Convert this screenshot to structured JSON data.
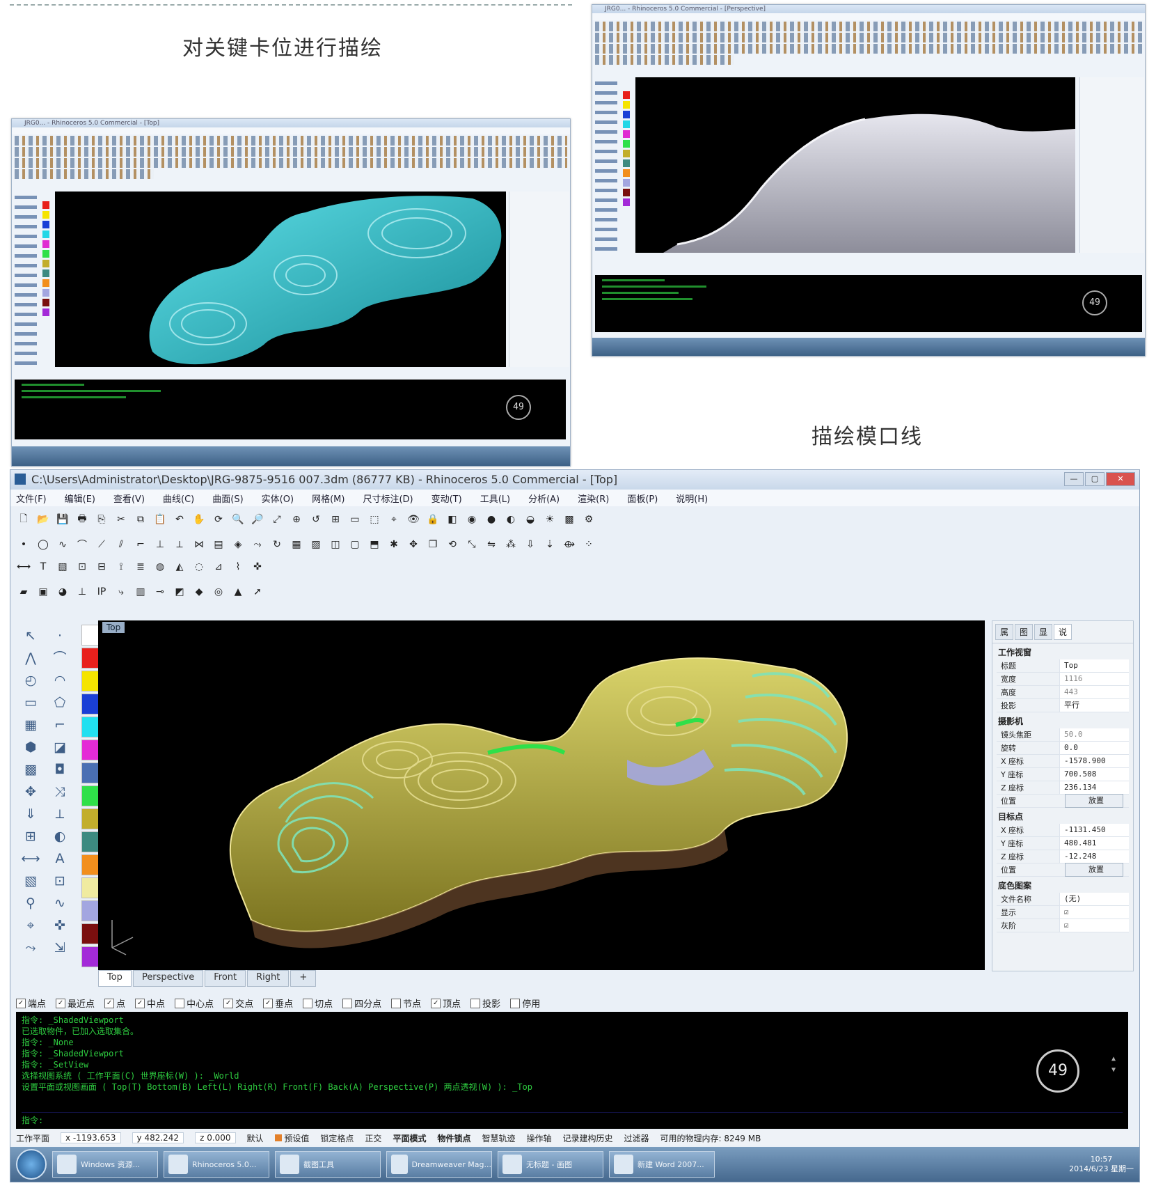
{
  "captions": {
    "top_left": "对关键卡位进行描绘",
    "right": "描绘模口线"
  },
  "colors": {
    "model_cyan": "#23b6c2",
    "model_olive": "#b7b03b",
    "model_green_lines": "#7fe3b8",
    "rhino_command_text": "#2ecc40"
  },
  "main_window": {
    "title": "C:\\Users\\Administrator\\Desktop\\JRG-9875-9516 007.3dm (86777 KB) - Rhinoceros 5.0 Commercial - [Top]",
    "window_buttons": [
      "—",
      "▢",
      "✕"
    ],
    "menu": [
      "文件(F)",
      "编辑(E)",
      "查看(V)",
      "曲线(C)",
      "曲面(S)",
      "实体(O)",
      "网格(M)",
      "尺寸标注(D)",
      "变动(T)",
      "工具(L)",
      "分析(A)",
      "渲染(R)",
      "面板(P)",
      "说明(H)"
    ],
    "viewport_label": "Top",
    "viewport_tabs": [
      "Top",
      "Perspective",
      "Front",
      "Right",
      "+"
    ],
    "osnaps": [
      {
        "label": "端点",
        "checked": true
      },
      {
        "label": "最近点",
        "checked": true
      },
      {
        "label": "点",
        "checked": true
      },
      {
        "label": "中点",
        "checked": true
      },
      {
        "label": "中心点",
        "checked": false
      },
      {
        "label": "交点",
        "checked": true
      },
      {
        "label": "垂点",
        "checked": true
      },
      {
        "label": "切点",
        "checked": false
      },
      {
        "label": "四分点",
        "checked": false
      },
      {
        "label": "节点",
        "checked": false
      },
      {
        "label": "顶点",
        "checked": true
      },
      {
        "label": "投影",
        "checked": false
      },
      {
        "label": "停用",
        "checked": false
      }
    ],
    "command_lines": [
      "指令: _ShadedViewport",
      "  已选取物件，已加入选取集合。",
      "指令: _None",
      "指令: _ShadedViewport",
      "指令: _SetView",
      "选择视图系统 ( 工作平面(C)  世界座标(W) ): _World",
      "设置平面或视图画面 ( Top(T)  Bottom(B)  Left(L)  Right(R)  Front(F)  Back(A)  Perspective(P)  两点透视(W) ): _Top"
    ],
    "command_prompt": "指令:",
    "performance": "49",
    "status_bar": {
      "plane": "工作平面",
      "x": "x -1193.653",
      "y": "y 482.242",
      "z": "z 0.000",
      "layer_label": "默认",
      "swatch_layer": "预设值",
      "toggles": [
        "锁定格点",
        "正交",
        "平面模式",
        "物件锁点",
        "智慧轨迹",
        "操作轴",
        "记录建构历史",
        "过滤器"
      ],
      "memory": "可用的物理内存: 8249 MB"
    },
    "taskbar": {
      "items": [
        "Windows 资源...",
        "Rhinoceros 5.0...",
        "截图工具",
        "Dreamweaver Mag...",
        "无标题 - 画图",
        "新建 Word 2007..."
      ],
      "time": "10:57",
      "date": "2014/6/23 星期一"
    }
  },
  "properties_panel": {
    "tabs": [
      "属",
      "图",
      "显",
      "说"
    ],
    "sections": [
      {
        "title": "工作视窗",
        "rows": [
          {
            "k": "标题",
            "v": "Top"
          },
          {
            "k": "宽度",
            "v": "1116"
          },
          {
            "k": "高度",
            "v": "443"
          },
          {
            "k": "投影",
            "v": "平行"
          }
        ]
      },
      {
        "title": "摄影机",
        "rows": [
          {
            "k": "镜头焦距",
            "v": "50.0"
          },
          {
            "k": "旋转",
            "v": "0.0"
          },
          {
            "k": "X 座标",
            "v": "-1578.900"
          },
          {
            "k": "Y 座标",
            "v": "700.508"
          },
          {
            "k": "Z 座标",
            "v": "236.134"
          },
          {
            "k": "位置",
            "v": "放置"
          }
        ]
      },
      {
        "title": "目标点",
        "rows": [
          {
            "k": "X 座标",
            "v": "-1131.450"
          },
          {
            "k": "Y 座标",
            "v": "480.481"
          },
          {
            "k": "Z 座标",
            "v": "-12.248"
          },
          {
            "k": "位置",
            "v": "放置"
          }
        ]
      },
      {
        "title": "底色图案",
        "rows": [
          {
            "k": "文件名称",
            "v": "(无)"
          },
          {
            "k": "显示",
            "v": "☑"
          },
          {
            "k": "灰阶",
            "v": "☑"
          }
        ]
      }
    ]
  },
  "small_windows": {
    "left_title": "JRG0... - Rhinoceros 5.0 Commercial - [Top]",
    "right_title": "JRG0... - Rhinoceros 5.0 Commercial - [Perspective]",
    "perf_left": "49",
    "perf_right": "49"
  }
}
